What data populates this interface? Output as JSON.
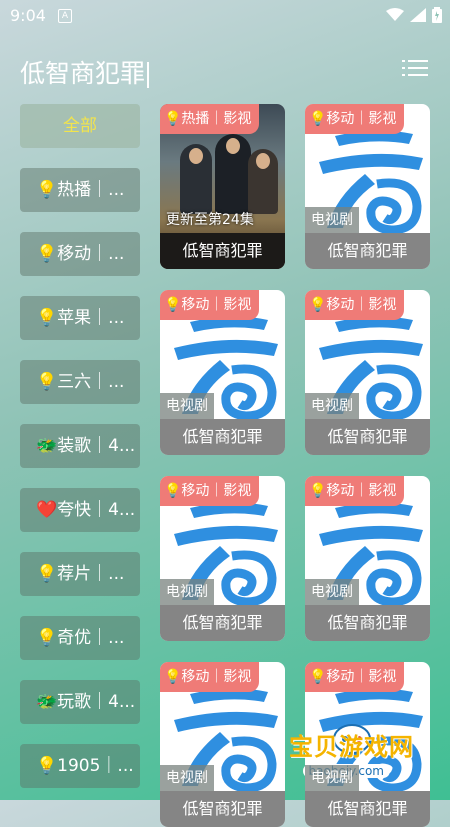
{
  "status_bar": {
    "time": "9:04",
    "notification_icon_text": "A"
  },
  "header": {
    "search_text": "低智商犯罪"
  },
  "sidebar": {
    "items": [
      {
        "label": "全部",
        "active": true
      },
      {
        "label": "💡热播｜..."
      },
      {
        "label": "💡移动｜..."
      },
      {
        "label": "💡苹果｜..."
      },
      {
        "label": "💡三六｜..."
      },
      {
        "label": "🐲装歌｜4..."
      },
      {
        "label": "❤️夸快｜4..."
      },
      {
        "label": "💡荐片｜..."
      },
      {
        "label": "💡奇优｜..."
      },
      {
        "label": "🐲玩歌｜4..."
      },
      {
        "label": "💡1905｜..."
      }
    ]
  },
  "results": [
    {
      "badge": "💡热播｜影视",
      "caption": "更新至第24集",
      "title": "低智商犯罪",
      "poster": true
    },
    {
      "badge": "💡移动｜影视",
      "caption": "电视剧",
      "title": "低智商犯罪"
    },
    {
      "badge": "💡移动｜影视",
      "caption": "电视剧",
      "title": "低智商犯罪"
    },
    {
      "badge": "💡移动｜影视",
      "caption": "电视剧",
      "title": "低智商犯罪"
    },
    {
      "badge": "💡移动｜影视",
      "caption": "电视剧",
      "title": "低智商犯罪"
    },
    {
      "badge": "💡移动｜影视",
      "caption": "电视剧",
      "title": "低智商犯罪"
    },
    {
      "badge": "💡移动｜影视",
      "caption": "电视剧",
      "title": "低智商犯罪"
    },
    {
      "badge": "💡移动｜影视",
      "caption": "电视剧",
      "title": "低智商犯罪"
    }
  ],
  "watermark": {
    "text": "宝贝游戏网",
    "url": "baobeiy.com"
  },
  "colors": {
    "badge": "#ef7b77",
    "logo_blue": "#2f8fe0",
    "active_text": "#f2e44c"
  }
}
